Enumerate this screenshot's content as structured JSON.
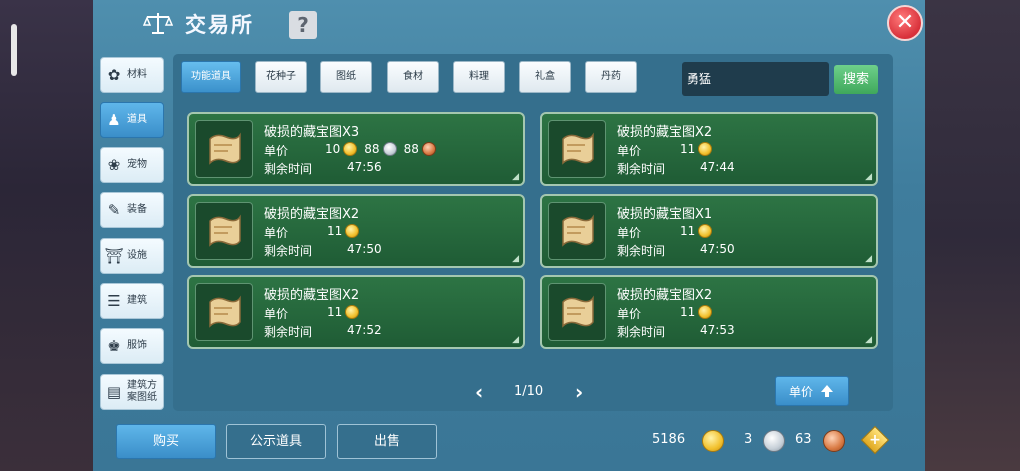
{
  "header": {
    "title": "交易所",
    "help_label": "?",
    "close_label": "✕"
  },
  "sidebar": {
    "items": [
      {
        "label": "材料",
        "icon": "materials-icon",
        "glyph": "✿",
        "active": false
      },
      {
        "label": "道具",
        "icon": "props-icon",
        "glyph": "♟",
        "active": true
      },
      {
        "label": "宠物",
        "icon": "pet-paw-icon",
        "glyph": "❀",
        "active": false
      },
      {
        "label": "装备",
        "icon": "equipment-icon",
        "glyph": "✎",
        "active": false
      },
      {
        "label": "设施",
        "icon": "facility-icon",
        "glyph": "⛩",
        "active": false
      },
      {
        "label": "建筑",
        "icon": "building-icon",
        "glyph": "☰",
        "active": false
      },
      {
        "label": "服饰",
        "icon": "clothing-icon",
        "glyph": "♚",
        "active": false
      },
      {
        "label": "建筑方案图纸",
        "icon": "blueprint-icon",
        "glyph": "▤",
        "active": false
      }
    ]
  },
  "tabs": [
    {
      "label": "功能道具",
      "active": true
    },
    {
      "label": "花种子",
      "active": false
    },
    {
      "label": "图纸",
      "active": false
    },
    {
      "label": "食材",
      "active": false
    },
    {
      "label": "料理",
      "active": false
    },
    {
      "label": "礼盒",
      "active": false
    },
    {
      "label": "丹药",
      "active": false
    }
  ],
  "search": {
    "value": "勇猛",
    "button_label": "搜索"
  },
  "labels": {
    "price": "单价",
    "time_left": "剩余时间"
  },
  "listings": [
    {
      "name": "破损的藏宝图X3",
      "gold": "10",
      "silver": "88",
      "copper": "88",
      "time": "47:56"
    },
    {
      "name": "破损的藏宝图X2",
      "gold": "11",
      "time": "47:44"
    },
    {
      "name": "破损的藏宝图X2",
      "gold": "11",
      "time": "47:50"
    },
    {
      "name": "破损的藏宝图X1",
      "gold": "11",
      "time": "47:50"
    },
    {
      "name": "破损的藏宝图X2",
      "gold": "11",
      "time": "47:52"
    },
    {
      "name": "破损的藏宝图X2",
      "gold": "11",
      "time": "47:53"
    }
  ],
  "pager": {
    "text": "1/10",
    "prev": "‹",
    "next": "›"
  },
  "sort": {
    "label": "单价"
  },
  "actions": {
    "buy": "购买",
    "public": "公示道具",
    "sell": "出售"
  },
  "wallet": {
    "gold": "5186",
    "silver": "3",
    "copper": "63"
  },
  "colors": {
    "panel": "#3f7d9d",
    "card": "#2d7444",
    "accent": "#3a8ec9",
    "search_button": "#3fa85b",
    "close": "#d8303a"
  }
}
